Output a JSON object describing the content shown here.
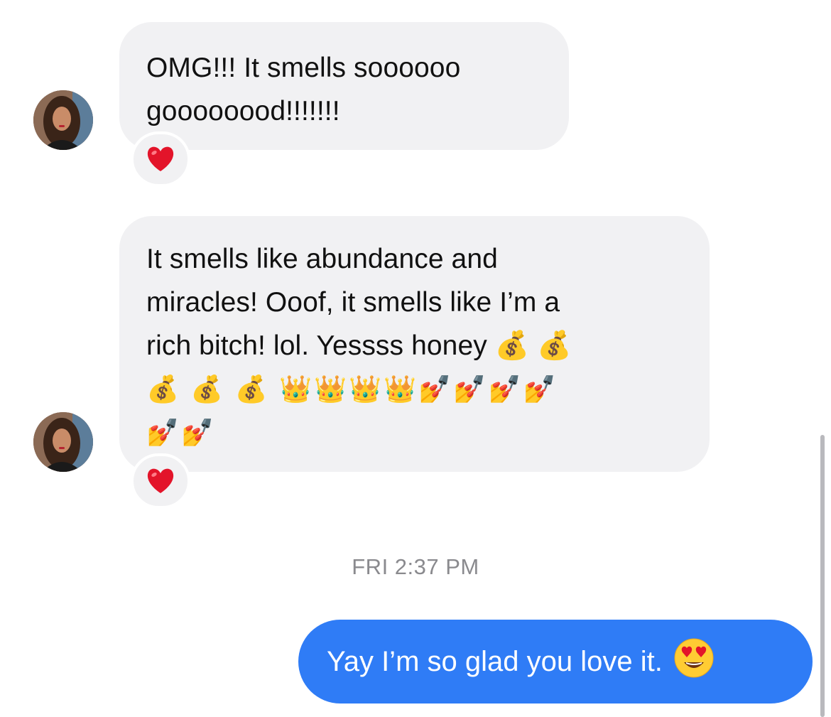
{
  "conversation": {
    "messages": [
      {
        "sender": "contact",
        "text": "OMG!!! It smells soooooo\ngoooooood!!!!!!!",
        "reaction": "heart",
        "reaction_color": "#e3142a"
      },
      {
        "sender": "contact",
        "text": "It smells like abundance and\nmiracles! Ooof, it smells like I’m a\nrich bitch! lol. Yessss honey 💰 💰",
        "emoji_line_1": "💰 💰 💰 👑👑👑👑💅💅💅💅",
        "emoji_line_2": "💅💅",
        "reaction": "heart",
        "reaction_color": "#e3142a"
      }
    ],
    "timestamp": "FRI 2:37 PM",
    "outgoing": {
      "text": "Yay I’m so glad you love it.",
      "emoji": "heart-eyes-emoji",
      "bubble_color": "#2f7cf6"
    }
  },
  "icons": {
    "avatar": "contact-avatar",
    "reaction": "heart-icon"
  }
}
